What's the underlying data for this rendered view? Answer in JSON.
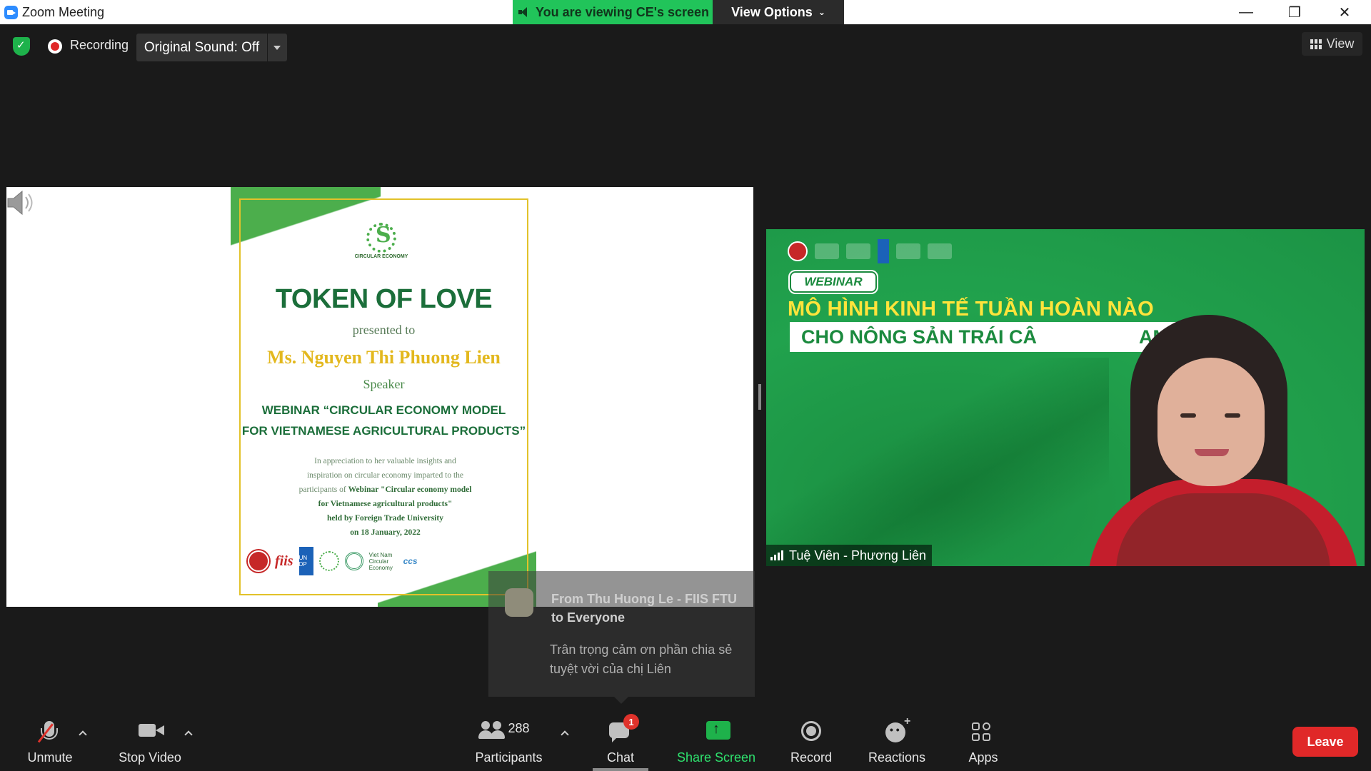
{
  "window": {
    "app_title": "Zoom Meeting",
    "viewing_banner": "You are viewing CE's screen",
    "view_options": "View Options",
    "minimize": "—",
    "restore": "❐",
    "close": "✕"
  },
  "top_bar": {
    "recording_label": "Recording",
    "original_sound": "Original Sound: Off",
    "view_label": "View"
  },
  "slide": {
    "logo_text": "CIRCULAR ECONOMY",
    "title": "TOKEN OF LOVE",
    "presented_to": "presented to",
    "name": "Ms. Nguyen Thi Phuong Lien",
    "role": "Speaker",
    "webinar_line1": "WEBINAR “CIRCULAR ECONOMY MODEL",
    "webinar_line2": "FOR VIETNAMESE AGRICULTURAL PRODUCTS”",
    "desc_line1": "In appreciation to her valuable insights and",
    "desc_line2": "inspiration on circular economy imparted to the",
    "desc_line3_plain": "participants of ",
    "desc_line3_bold": "Webinar \"Circular economy model",
    "desc_line4": "for Vietnamese agricultural products\"",
    "desc_line5": "held by Foreign Trade University",
    "desc_line6": "on 18 January, 2022",
    "logo_fiis": "fiis",
    "logo_undp": "UN DP",
    "logo_vnce": "Viet Nam Circular Economy",
    "logo_ccs": "ccs"
  },
  "video": {
    "webinar_tag": "WEBINAR",
    "headline1": "MÔ HÌNH KINH TẾ TUẦN HOÀN NÀO",
    "headline2": "CHO NÔNG SẢN TRÁI CÂ",
    "headline2_tail": "AM",
    "participant_name": "Tuệ Viên - Phương Liên"
  },
  "chat_toast": {
    "from": "From Thu Huong Le - FIIS FTU to Everyone",
    "message": "Trân trọng cảm ơn phần chia sẻ tuyệt vời của chị Liên"
  },
  "toolbar": {
    "unmute": "Unmute",
    "stop_video": "Stop Video",
    "participants_count": "288",
    "participants": "Participants",
    "chat": "Chat",
    "chat_badge": "1",
    "share_screen": "Share Screen",
    "record": "Record",
    "reactions": "Reactions",
    "apps": "Apps",
    "leave": "Leave"
  },
  "colors": {
    "share_green": "#1eb24b",
    "leave_red": "#e02828",
    "slide_title_green": "#1b6e3a",
    "slide_name_gold": "#e3b81e",
    "video_bg_green": "#1e9c48"
  }
}
